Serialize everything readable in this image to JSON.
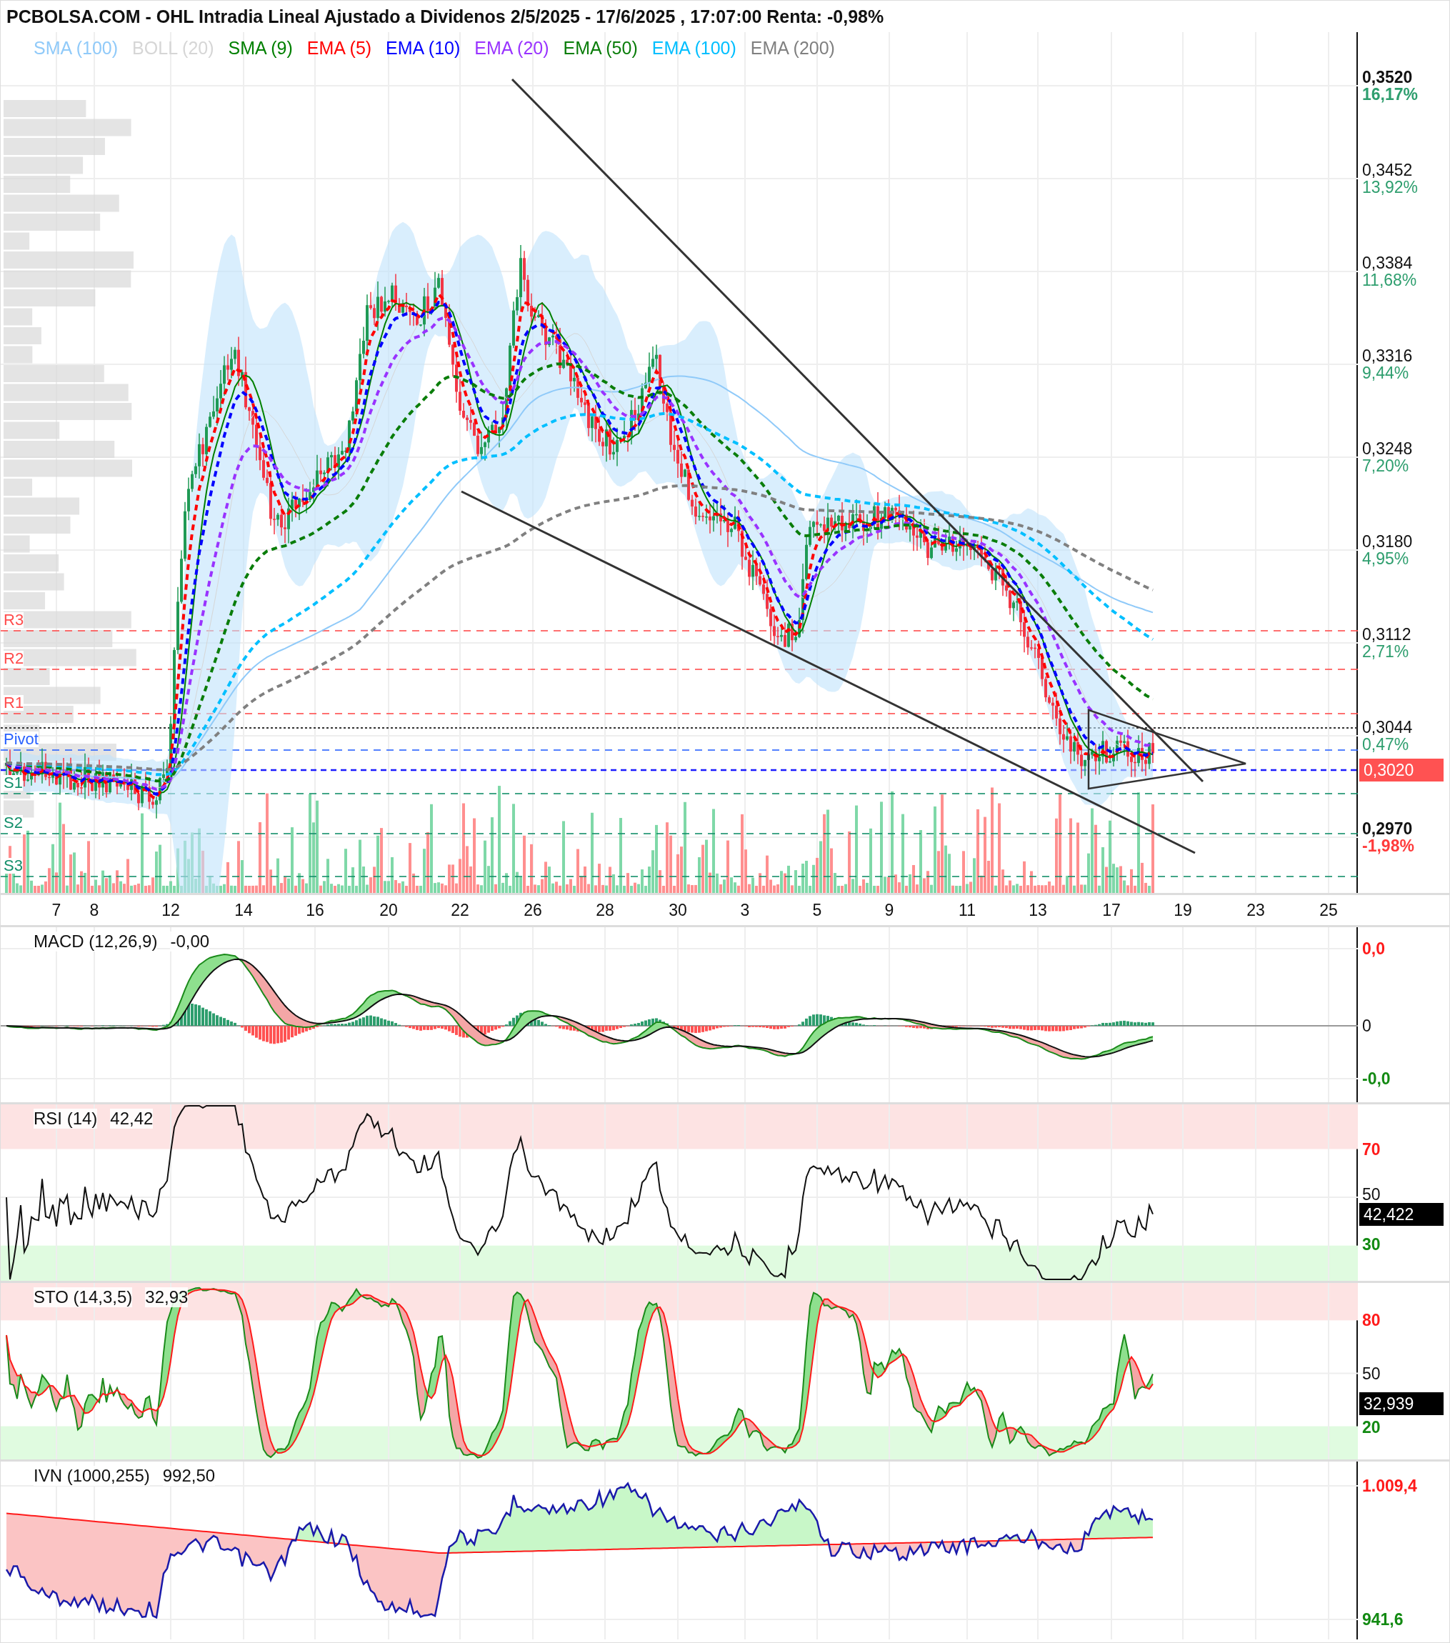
{
  "title": "PCBOLSA.COM - OHL Intradia Lineal Ajustado a Dividenos 2/5/2025 - 17/6/2025 , 17:07:00 Renta: -0,98%",
  "legend": [
    {
      "label": "SMA (100)",
      "color": "#90caf9"
    },
    {
      "label": "BOLL (20)",
      "color": "#d6d6d6"
    },
    {
      "label": "SMA (9)",
      "color": "#008000"
    },
    {
      "label": "EMA (5)",
      "color": "#ff0000"
    },
    {
      "label": "EMA (10)",
      "color": "#0000ff"
    },
    {
      "label": "EMA (20)",
      "color": "#9933ff"
    },
    {
      "label": "EMA (50)",
      "color": "#0a7d0a"
    },
    {
      "label": "EMA (100)",
      "color": "#00bfff"
    },
    {
      "label": "EMA (200)",
      "color": "#808080"
    }
  ],
  "pivots": [
    {
      "label": "R3",
      "color": "#ff4d4d"
    },
    {
      "label": "R2",
      "color": "#ff4d4d"
    },
    {
      "label": "R1",
      "color": "#ff4d4d"
    },
    {
      "label": "Pivot",
      "color": "#2962ff"
    },
    {
      "label": "S1",
      "color": "#138f6a"
    },
    {
      "label": "S2",
      "color": "#138f6a"
    },
    {
      "label": "S3",
      "color": "#138f6a"
    }
  ],
  "price_axis": [
    {
      "price": "0,3520",
      "change": "16,17%",
      "kind": "high"
    },
    {
      "price": "0,3452",
      "change": "13,92%",
      "kind": "tick"
    },
    {
      "price": "0,3384",
      "change": "11,68%",
      "kind": "tick"
    },
    {
      "price": "0,3316",
      "change": "9,44%",
      "kind": "tick"
    },
    {
      "price": "0,3248",
      "change": "7,20%",
      "kind": "tick"
    },
    {
      "price": "0,3180",
      "change": "4,95%",
      "kind": "tick"
    },
    {
      "price": "0,3112",
      "change": "2,71%",
      "kind": "tick"
    },
    {
      "price": "0,3044",
      "change": "0,47%",
      "kind": "tick"
    },
    {
      "price": "0,2970",
      "change": "-1,98%",
      "kind": "low"
    }
  ],
  "last_price": "0,3020",
  "dates": [
    "7",
    "8",
    "12",
    "14",
    "16",
    "20",
    "22",
    "26",
    "28",
    "30",
    "3",
    "5",
    "9",
    "11",
    "13",
    "17",
    "19",
    "23",
    "25"
  ],
  "macd": {
    "label": "MACD (12,26,9)",
    "value": "-0,00",
    "axis": [
      {
        "label": "0,0",
        "kind": "up"
      },
      {
        "label": "0",
        "kind": "mid"
      },
      {
        "label": "-0,0",
        "kind": "down"
      }
    ]
  },
  "rsi": {
    "label": "RSI (14)",
    "value": "42,42",
    "reading": "42,422",
    "axis": [
      {
        "label": "70",
        "kind": "up"
      },
      {
        "label": "50",
        "kind": "mid"
      },
      {
        "label": "30",
        "kind": "down"
      }
    ]
  },
  "sto": {
    "label": "STO (14,3,5)",
    "value": "32,93",
    "reading": "32,939",
    "axis": [
      {
        "label": "80",
        "kind": "up"
      },
      {
        "label": "50",
        "kind": "mid"
      },
      {
        "label": "20",
        "kind": "down"
      }
    ]
  },
  "ivn": {
    "label": "IVN (1000,255)",
    "value": "992,50",
    "axis": [
      {
        "label": "1.009,4",
        "kind": "up"
      },
      {
        "label": "941,6",
        "kind": "down"
      }
    ]
  }
}
